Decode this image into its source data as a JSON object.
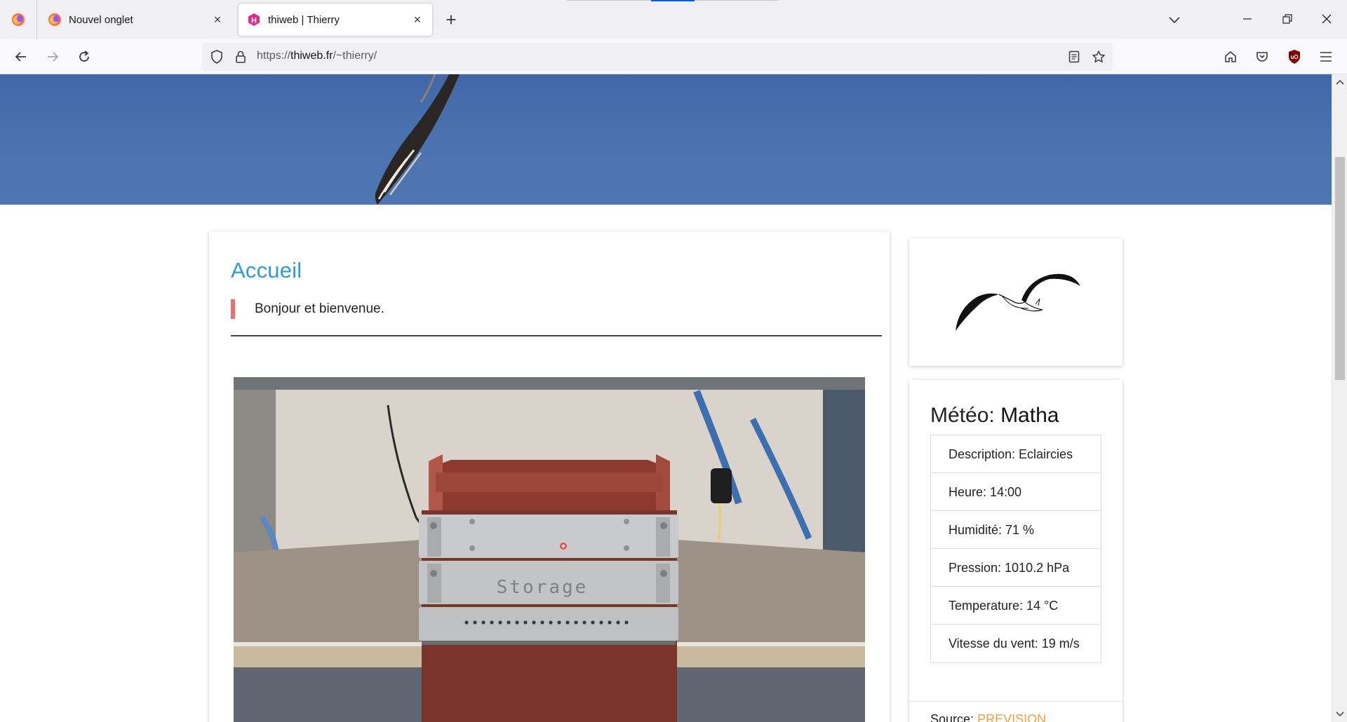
{
  "browser": {
    "tabs": [
      {
        "title": "Nouvel onglet",
        "active": false,
        "icon": "firefox-icon"
      },
      {
        "title": "thiweb | Thierry",
        "active": true,
        "icon": "thiweb-favicon"
      }
    ],
    "url_prefix": "https://",
    "url_domain": "thiweb.fr",
    "url_path": "/~thierry/",
    "colors": {
      "accent": "#0060df",
      "tabbar": "#f0f0f4"
    }
  },
  "page": {
    "heading": "Accueil",
    "welcome": "Bonjour et bienvenue.",
    "photo_label": "Storage",
    "meteo": {
      "label": "Météo:",
      "city": "Matha",
      "rows": [
        "Description: Eclaircies",
        "Heure: 14:00",
        "Humidité: 71 %",
        "Pression: 1010.2 hPa",
        "Temperature: 14 °C",
        "Vitesse du vent: 19 m/s"
      ],
      "source_label": "Source:",
      "source_link": "PREVISION"
    },
    "colors": {
      "heading": "#2d9cdb",
      "quote_border": "#ee6d6d",
      "link": "#f0a040",
      "hero": "#4a73b0"
    }
  }
}
